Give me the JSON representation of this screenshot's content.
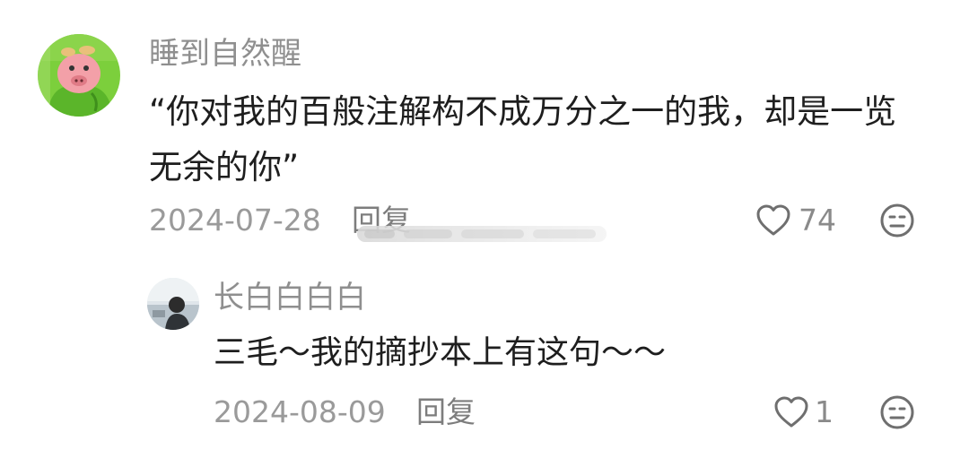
{
  "comments": [
    {
      "username": "睡到自然醒",
      "content": "“你对我的百般注解构不成万分之一的我，却是一览无余的你”",
      "date": "2024-07-28",
      "reply_label": "回复",
      "likes": "74",
      "avatar_icon": "cartoon-pig-avatar"
    },
    {
      "username": "长白白白白",
      "content": "三毛～我的摘抄本上有这句～～",
      "date": "2024-08-09",
      "reply_label": "回复",
      "likes": "1",
      "avatar_icon": "photo-avatar"
    }
  ],
  "icons": {
    "like": "heart-outline-icon",
    "dislike": "unhappy-face-icon"
  },
  "colors": {
    "text_primary": "#1e1e1e",
    "text_secondary": "#8f8f8f",
    "icon_gray": "#6f6f6f",
    "pig_avatar_bg": "#7ccf3c"
  }
}
